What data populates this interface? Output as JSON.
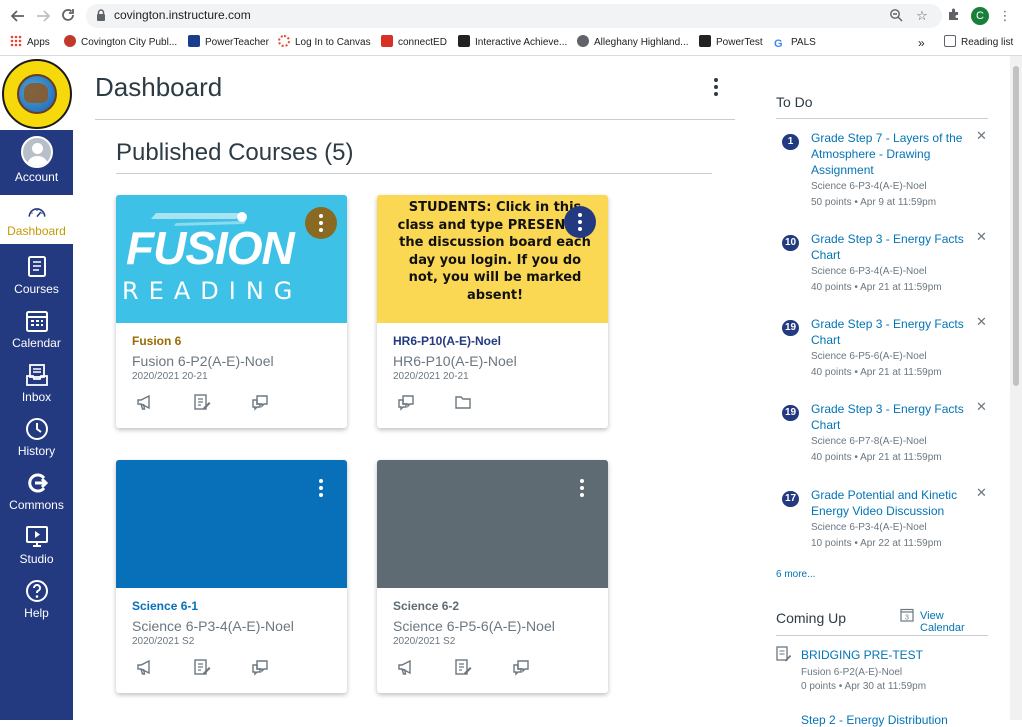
{
  "browser": {
    "url": "covington.instructure.com",
    "profile_initial": "C",
    "bookmarks": [
      {
        "label": "Apps",
        "color": "#5f6368"
      },
      {
        "label": "Covington City Publ...",
        "color": "#c0392b"
      },
      {
        "label": "PowerTeacher",
        "color": "#1a3e8c"
      },
      {
        "label": "Log In to Canvas",
        "color": "#e34c26"
      },
      {
        "label": "connectED",
        "color": "#d93025"
      },
      {
        "label": "Interactive Achieve...",
        "color": "#222222"
      },
      {
        "label": "Alleghany Highland...",
        "color": "#444444"
      },
      {
        "label": "PowerTest",
        "color": "#222222"
      },
      {
        "label": "PALS",
        "color": "#4285f4"
      }
    ],
    "overflow_label": "»",
    "reading_list": "Reading list"
  },
  "global_nav": {
    "items": [
      {
        "label": "Account",
        "icon": "account-avatar"
      },
      {
        "label": "Dashboard",
        "icon": "dashboard-icon",
        "active": true
      },
      {
        "label": "Courses",
        "icon": "courses-icon"
      },
      {
        "label": "Calendar",
        "icon": "calendar-icon"
      },
      {
        "label": "Inbox",
        "icon": "inbox-icon"
      },
      {
        "label": "History",
        "icon": "history-icon"
      },
      {
        "label": "Commons",
        "icon": "commons-icon"
      },
      {
        "label": "Studio",
        "icon": "studio-icon"
      },
      {
        "label": "Help",
        "icon": "help-icon"
      }
    ],
    "brand_color": "#243a80",
    "active_label_color": "#c49a00"
  },
  "main": {
    "title": "Dashboard",
    "section_title": "Published Courses (5)",
    "cards": [
      {
        "hero": "fusion",
        "hero_text_1": "FUSION",
        "hero_text_2": "READING",
        "short_name": "Fusion 6",
        "short_color": "#9a6b00",
        "name": "Fusion 6-P2(A-E)-Noel",
        "term": "2020/2021 20-21",
        "kebab_color": "#8a6a22",
        "icons": [
          "announcements-icon",
          "assignments-icon",
          "discussions-icon"
        ]
      },
      {
        "hero": "students",
        "hero_text": "STUDENTS: Click in this class and type PRESENT in the discussion board each day you login. If you do not, you will be marked absent!",
        "short_name": "HR6-P10(A-E)-Noel",
        "short_color": "#243a80",
        "name": "HR6-P10(A-E)-Noel",
        "term": "2020/2021 20-21",
        "kebab_color": "#243a80",
        "icons": [
          "discussions-icon",
          "files-icon"
        ]
      },
      {
        "hero": "solid",
        "hero_color": "#0770b8",
        "short_name": "Science 6-1",
        "short_color": "#0770b8",
        "name": "Science 6-P3-4(A-E)-Noel",
        "term": "2020/2021 S2",
        "kebab_color": "transparent",
        "icons": [
          "announcements-icon",
          "assignments-icon",
          "discussions-icon"
        ]
      },
      {
        "hero": "solid",
        "hero_color": "#5e6b73",
        "short_name": "Science 6-2",
        "short_color": "#5e6b73",
        "name": "Science 6-P5-6(A-E)-Noel",
        "term": "2020/2021 S2",
        "kebab_color": "transparent",
        "icons": [
          "announcements-icon",
          "assignments-icon",
          "discussions-icon"
        ]
      }
    ]
  },
  "sidebar": {
    "todo_heading": "To Do",
    "todos": [
      {
        "badge": "1",
        "title": "Grade Step 7 - Layers of the Atmosphere - Drawing Assignment",
        "course": "Science 6-P3-4(A-E)-Noel",
        "meta": "50 points • Apr 9 at 11:59pm"
      },
      {
        "badge": "10",
        "title": "Grade Step 3 - Energy Facts Chart",
        "course": "Science 6-P3-4(A-E)-Noel",
        "meta": "40 points • Apr 21 at 11:59pm"
      },
      {
        "badge": "19",
        "title": "Grade Step 3 - Energy Facts Chart",
        "course": "Science 6-P5-6(A-E)-Noel",
        "meta": "40 points • Apr 21 at 11:59pm"
      },
      {
        "badge": "19",
        "title": "Grade Step 3 - Energy Facts Chart",
        "course": "Science 6-P7-8(A-E)-Noel",
        "meta": "40 points • Apr 21 at 11:59pm"
      },
      {
        "badge": "17",
        "title": "Grade Potential and Kinetic Energy Video Discussion",
        "course": "Science 6-P3-4(A-E)-Noel",
        "meta": "10 points • Apr 22 at 11:59pm"
      }
    ],
    "more_link": "6 more...",
    "coming_up_heading": "Coming Up",
    "view_calendar": "View Calendar",
    "calendar_day": "3",
    "coming_up": [
      {
        "title": "BRIDGING PRE-TEST",
        "course": "Fusion 6-P2(A-E)-Noel",
        "meta": "0 points • Apr 30 at 11:59pm"
      }
    ],
    "next_partial": "Step 2 - Energy Distribution"
  }
}
